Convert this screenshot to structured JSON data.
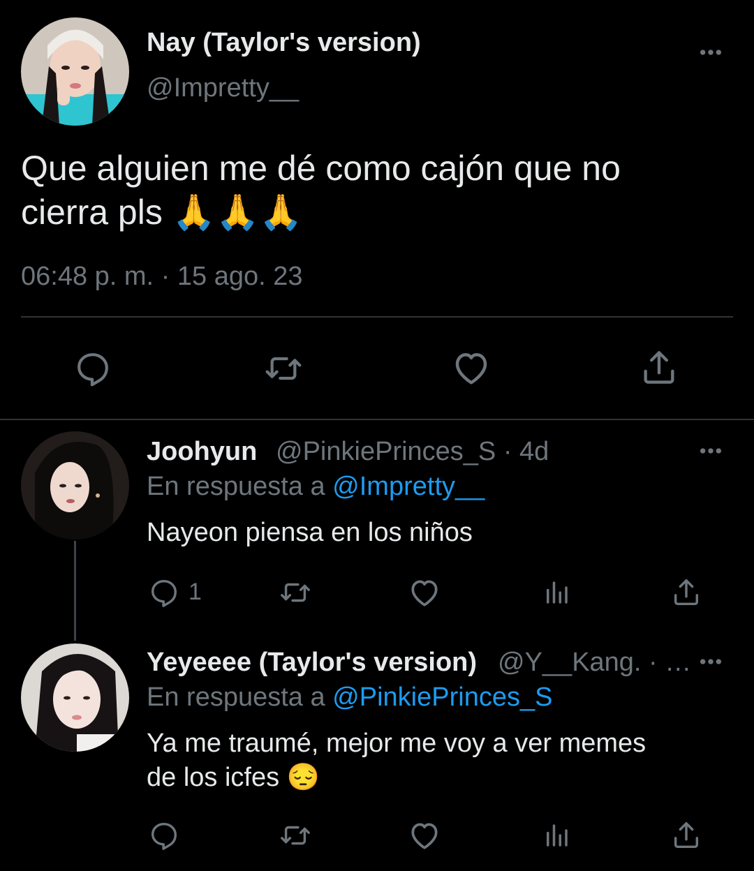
{
  "main_tweet": {
    "author_name": "Nay (Taylor's version)",
    "handle": "@Impretty__",
    "text_line1": "Que alguien me dé como cajón que no",
    "text_line2": "cierra pls 🙏🙏🙏",
    "timestamp": "06:48 p. m. · 15 ago. 23",
    "more_label": "•••"
  },
  "reply1": {
    "author_name": "Joohyun",
    "handle_meta": "@PinkiePrinces_S · 4d",
    "reply_to_prefix": "En respuesta a",
    "reply_to_handle": "@Impretty__",
    "text": "Nayeon piensa en los niños",
    "reply_count": "1",
    "more_label": "•••"
  },
  "reply2": {
    "author_name": "Yeyeeee (Taylor's version)",
    "handle_meta": "@Y__Kang. · …",
    "reply_to_prefix": "En respuesta a",
    "reply_to_handle": "@PinkiePrinces_S",
    "text_line1": "Ya me traumé, mejor me voy a ver memes",
    "text_line2": "de los icfes 😔",
    "more_label": "•••"
  },
  "icons": [
    "reply-icon",
    "retweet-icon",
    "like-icon",
    "share-icon",
    "views-icon",
    "more-icon"
  ],
  "colors": {
    "background": "#000000",
    "text": "#e7e9ea",
    "muted": "#6e767d",
    "link": "#1d9bf0",
    "divider": "#2f3336"
  }
}
